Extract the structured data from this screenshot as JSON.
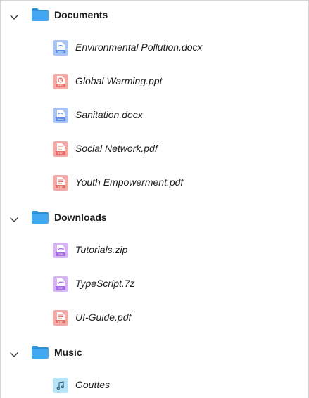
{
  "tree": {
    "folders": [
      {
        "name": "Documents",
        "icon": "folder-icon",
        "expanded": true,
        "files": [
          {
            "name": "Environmental Pollution.docx",
            "icon": "word-doc-icon",
            "type_label": "Word"
          },
          {
            "name": "Global Warming.ppt",
            "icon": "powerpoint-icon",
            "type_label": "PPT"
          },
          {
            "name": "Sanitation.docx",
            "icon": "word-doc-icon",
            "type_label": "Word"
          },
          {
            "name": "Social Network.pdf",
            "icon": "pdf-icon",
            "type_label": "PDF"
          },
          {
            "name": "Youth Empowerment.pdf",
            "icon": "pdf-icon",
            "type_label": "PDF"
          }
        ]
      },
      {
        "name": "Downloads",
        "icon": "folder-icon",
        "expanded": true,
        "files": [
          {
            "name": "Tutorials.zip",
            "icon": "zip-icon",
            "type_label": "ZIP"
          },
          {
            "name": "TypeScript.7z",
            "icon": "zip-icon",
            "type_label": "ZIP"
          },
          {
            "name": "UI-Guide.pdf",
            "icon": "pdf-icon",
            "type_label": "PDF"
          }
        ]
      },
      {
        "name": "Music",
        "icon": "folder-icon",
        "expanded": true,
        "files": [
          {
            "name": "Gouttes",
            "icon": "music-icon",
            "type_label": ""
          }
        ]
      }
    ]
  },
  "colors": {
    "folder": "#43a8f0",
    "folder_tab": "#2b8fd8",
    "word": "#5b8de6",
    "word_bg": "#a9c4f3",
    "ppt": "#e8706a",
    "ppt_bg": "#f3a9a5",
    "pdf": "#e8706a",
    "pdf_bg": "#f3a9a5",
    "zip": "#a86de0",
    "zip_bg": "#d5b4f2",
    "music": "#3a9bd0",
    "music_bg": "#b6e3f6"
  }
}
